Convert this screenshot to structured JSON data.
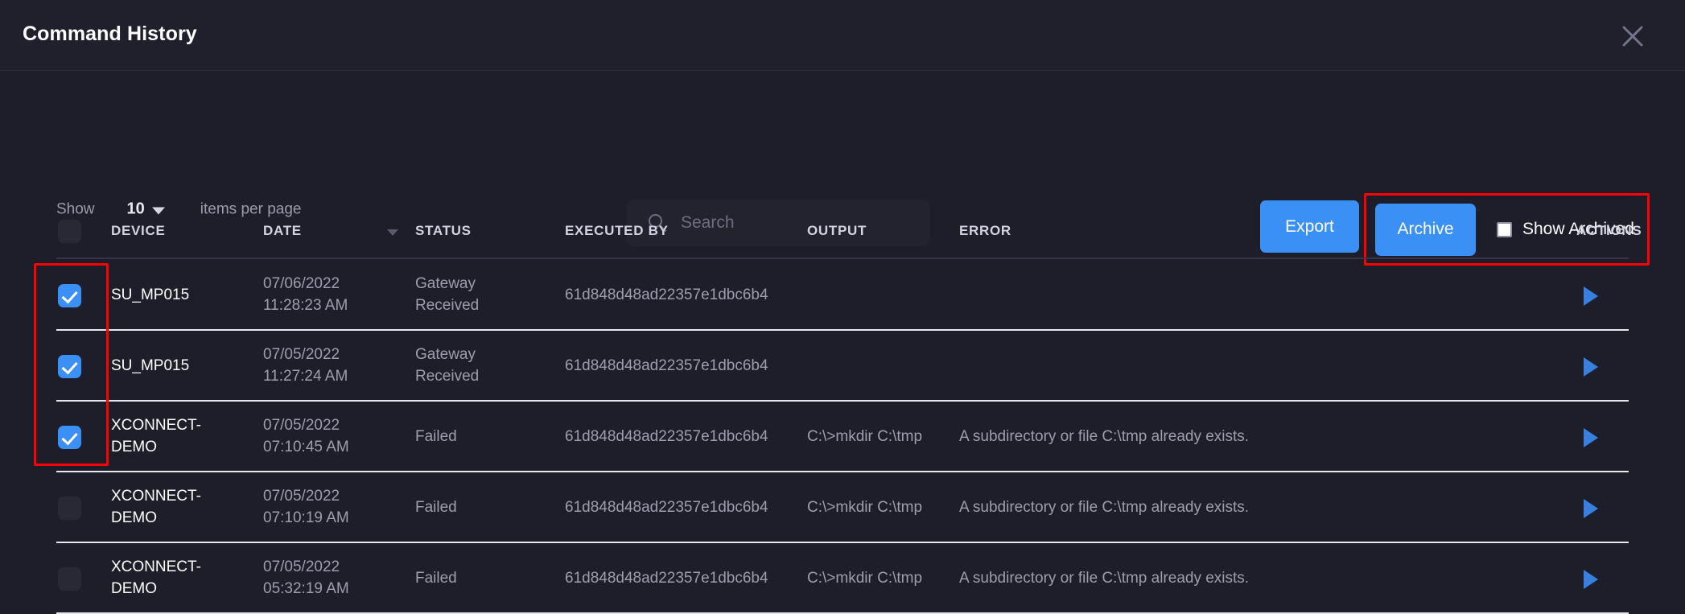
{
  "window": {
    "title": "Command History",
    "close_icon": "close-icon"
  },
  "toolbar": {
    "show_label": "Show",
    "page_size_value": "10",
    "items_per_page_label": "items per page",
    "search": {
      "placeholder": "Search",
      "value": "",
      "icon": "search-icon"
    },
    "export_label": "Export",
    "archive_label": "Archive",
    "show_archived_label": "Show Archived",
    "show_archived_checked": false,
    "accent_color": "#3b90f5",
    "highlight_color": "#ff0000"
  },
  "table": {
    "columns": [
      {
        "key": "select",
        "label": ""
      },
      {
        "key": "device",
        "label": "DEVICE"
      },
      {
        "key": "date",
        "label": "DATE"
      },
      {
        "key": "status",
        "label": "STATUS"
      },
      {
        "key": "executed_by",
        "label": "EXECUTED BY"
      },
      {
        "key": "output",
        "label": "OUTPUT"
      },
      {
        "key": "error",
        "label": "ERROR"
      },
      {
        "key": "actions",
        "label": "ACTIONS"
      }
    ],
    "sorted_column": "DATE",
    "sort_direction": "desc",
    "header_checkbox_checked": false,
    "rows": [
      {
        "selected": true,
        "device": "SU_MP015",
        "date": "07/06/2022",
        "time": "11:28:23 AM",
        "status": "Gateway Received",
        "executed_by": "61d848d48ad22357e1dbc6b4",
        "output": "",
        "error": ""
      },
      {
        "selected": true,
        "device": "SU_MP015",
        "date": "07/05/2022",
        "time": "11:27:24 AM",
        "status": "Gateway Received",
        "executed_by": "61d848d48ad22357e1dbc6b4",
        "output": "",
        "error": ""
      },
      {
        "selected": true,
        "device": "XCONNECT-DEMO",
        "date": "07/05/2022",
        "time": "07:10:45 AM",
        "status": "Failed",
        "executed_by": "61d848d48ad22357e1dbc6b4",
        "output": "C:\\>mkdir C:\\tmp",
        "error": "A subdirectory or file C:\\tmp already exists."
      },
      {
        "selected": false,
        "device": "XCONNECT-DEMO",
        "date": "07/05/2022",
        "time": "07:10:19 AM",
        "status": "Failed",
        "executed_by": "61d848d48ad22357e1dbc6b4",
        "output": "C:\\>mkdir C:\\tmp",
        "error": "A subdirectory or file C:\\tmp already exists."
      },
      {
        "selected": false,
        "device": "XCONNECT-DEMO",
        "date": "07/05/2022",
        "time": "05:32:19 AM",
        "status": "Failed",
        "executed_by": "61d848d48ad22357e1dbc6b4",
        "output": "C:\\>mkdir C:\\tmp",
        "error": "A subdirectory or file C:\\tmp already exists."
      }
    ]
  }
}
